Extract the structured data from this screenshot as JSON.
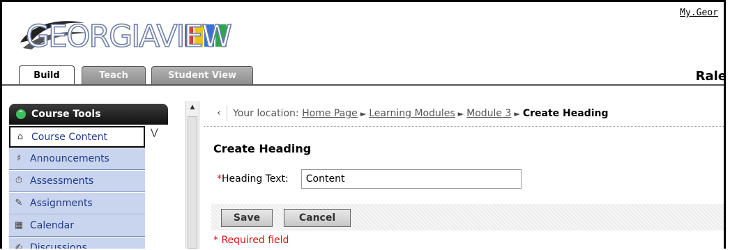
{
  "header": {
    "logo_text": "GEORGIAVIEW",
    "my_link": "My.Geor",
    "user_name": "Rale"
  },
  "tabs": [
    {
      "label": "Build",
      "active": true
    },
    {
      "label": "Teach",
      "active": false
    },
    {
      "label": "Student View",
      "active": false
    }
  ],
  "sidebar": {
    "heading": "Course Tools",
    "items": [
      {
        "label": "Course Content",
        "icon": "home-icon",
        "selected": true
      },
      {
        "label": "Announcements",
        "icon": "megaphone-icon"
      },
      {
        "label": "Assessments",
        "icon": "stopwatch-icon"
      },
      {
        "label": "Assignments",
        "icon": "pencil-icon"
      },
      {
        "label": "Calendar",
        "icon": "calendar-icon"
      },
      {
        "label": "Discussions",
        "icon": "discussion-icon"
      }
    ]
  },
  "breadcrumb": {
    "prefix": "Your location:",
    "items": [
      "Home Page",
      "Learning Modules",
      "Module 3"
    ],
    "current": "Create Heading"
  },
  "form": {
    "title": "Create Heading",
    "required_mark": "*",
    "field_label": "Heading Text:",
    "field_value": "Content",
    "save_label": "Save",
    "cancel_label": "Cancel",
    "required_note": "* Required field"
  },
  "colors": {
    "accent_red": "#e01010",
    "nav_bg": "#c9d4ee",
    "nav_text": "#1f3a8a",
    "tool_header": "#111111"
  }
}
